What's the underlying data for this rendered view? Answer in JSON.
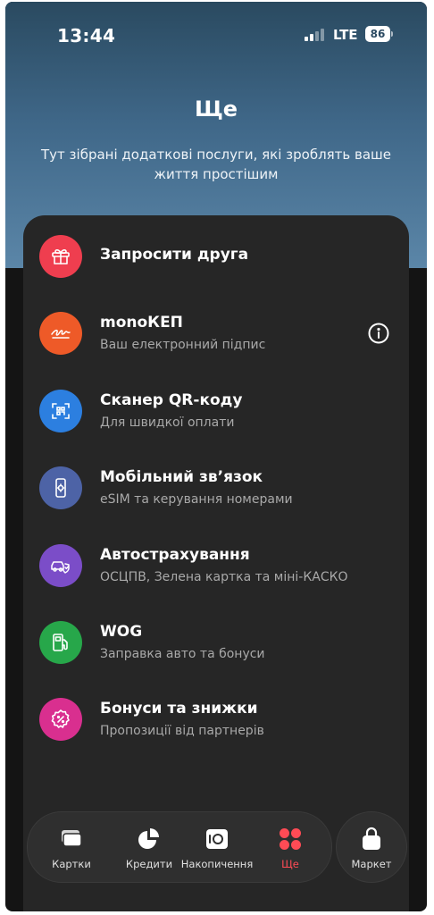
{
  "status": {
    "time": "13:44",
    "network": "LTE",
    "battery": "86",
    "signal_bars_filled": 2
  },
  "header": {
    "title": "Ще",
    "subtitle": "Тут зібрані додаткові послуги, які зроблять ваше життя простішим"
  },
  "services": [
    {
      "title": "Запросити друга",
      "subtitle": "",
      "icon": "gift-icon",
      "color": "#ef3e4f"
    },
    {
      "title": "monoКЕП",
      "subtitle": "Ваш електронний підпис",
      "icon": "signature-icon",
      "color": "#ee5a28",
      "info_icon": "info-icon"
    },
    {
      "title": "Сканер QR-коду",
      "subtitle": "Для швидкої оплати",
      "icon": "qr-scanner-icon",
      "color": "#2c7fe0"
    },
    {
      "title": "Мобільний зв’язок",
      "subtitle": "eSIM та керування номерами",
      "icon": "phone-settings-icon",
      "color": "#4d63a6"
    },
    {
      "title": "Автострахування",
      "subtitle": "ОСЦПВ, Зелена картка та міні-КАСКО",
      "icon": "car-insurance-icon",
      "color": "#7b4dc8"
    },
    {
      "title": "WOG",
      "subtitle": "Заправка авто та бонуси",
      "icon": "fuel-station-icon",
      "color": "#27a74a"
    },
    {
      "title": "Бонуси та знижки",
      "subtitle": "Пропозиції від партнерів",
      "icon": "discount-icon",
      "color": "#d92f8f"
    }
  ],
  "nav": {
    "items": [
      {
        "label": "Картки",
        "icon": "cards-icon"
      },
      {
        "label": "Кредити",
        "icon": "pie-chart-icon"
      },
      {
        "label": "Накопичення",
        "icon": "safe-icon"
      },
      {
        "label": "Ще",
        "icon": "more-dots-icon",
        "active": true
      }
    ],
    "market": {
      "label": "Маркет",
      "icon": "shopping-bag-icon"
    }
  },
  "colors": {
    "accent": "#ff4b55",
    "card_bg": "#262626",
    "hero_top": "#2a4a60",
    "hero_bottom": "#5b86a8"
  }
}
